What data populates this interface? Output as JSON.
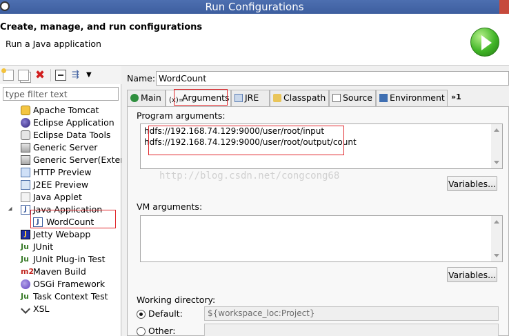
{
  "window": {
    "title": "Run Configurations"
  },
  "header": {
    "heading": "Create, manage, and run configurations",
    "subheading": "Run a Java application"
  },
  "left": {
    "toolbar": {
      "icons": [
        "new-config-icon",
        "duplicate-icon",
        "delete-icon",
        "collapse-all-icon",
        "filter-icon",
        "view-menu-icon"
      ]
    },
    "filter_placeholder": "type filter text",
    "tree": [
      {
        "label": "Apache Tomcat",
        "icon": "tomcat-icon"
      },
      {
        "label": "Eclipse Application",
        "icon": "eclipse-icon"
      },
      {
        "label": "Eclipse Data Tools",
        "icon": "data-tools-icon"
      },
      {
        "label": "Generic Server",
        "icon": "server-icon"
      },
      {
        "label": "Generic Server(Extern",
        "icon": "server-icon"
      },
      {
        "label": "HTTP Preview",
        "icon": "http-icon"
      },
      {
        "label": "J2EE Preview",
        "icon": "j2ee-icon"
      },
      {
        "label": "Java Applet",
        "icon": "applet-icon"
      },
      {
        "label": "Java Application",
        "icon": "java-app-icon",
        "expanded": true
      },
      {
        "label": "WordCount",
        "icon": "java-app-icon",
        "selected": true
      },
      {
        "label": "Jetty Webapp",
        "icon": "jetty-icon"
      },
      {
        "label": "JUnit",
        "icon": "junit-icon"
      },
      {
        "label": "JUnit Plug-in Test",
        "icon": "junit-icon"
      },
      {
        "label": "Maven Build",
        "icon": "maven-icon"
      },
      {
        "label": "OSGi Framework",
        "icon": "osgi-icon"
      },
      {
        "label": "Task Context Test",
        "icon": "junit-icon"
      },
      {
        "label": "XSL",
        "icon": "xsl-icon"
      }
    ]
  },
  "form": {
    "name_label": "Name:",
    "name_value": "WordCount",
    "tabs": [
      {
        "label": "Main",
        "icon": "main-tab-icon"
      },
      {
        "label": "Arguments",
        "icon": "arguments-tab-icon",
        "active": true
      },
      {
        "label": "JRE",
        "icon": "jre-tab-icon"
      },
      {
        "label": "Classpath",
        "icon": "classpath-tab-icon"
      },
      {
        "label": "Source",
        "icon": "source-tab-icon"
      },
      {
        "label": "Environment",
        "icon": "environment-tab-icon"
      }
    ],
    "more_tabs": "»1",
    "program_args_label": "Program arguments:",
    "program_args_lines": [
      "hdfs://192.168.74.129:9000/user/root/input",
      "hdfs://192.168.74.129:9000/user/root/output/count"
    ],
    "variables_label": "Variables...",
    "vm_args_label": "VM arguments:",
    "vm_args_value": "",
    "working_dir_label": "Working directory:",
    "default_label": "Default:",
    "default_value": "${workspace_loc:Project}",
    "other_label": "Other:",
    "watermark": "http://blog.csdn.net/congcong68"
  },
  "colors": {
    "highlight_box": "#e0262a",
    "run_button": "#41b527"
  }
}
